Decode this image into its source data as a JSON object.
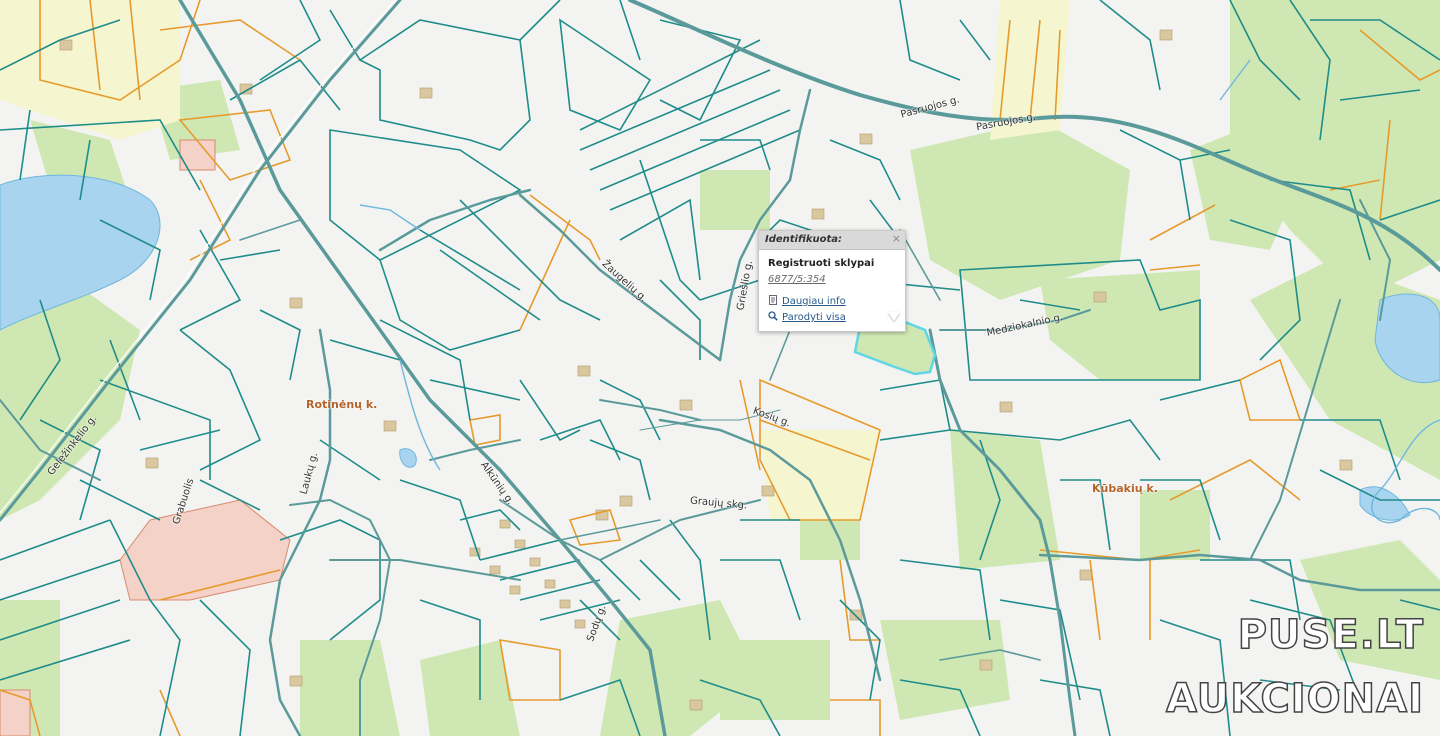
{
  "popup": {
    "title": "Identifikuota:",
    "close_label": "×",
    "layer_label": "Registruoti sklypai",
    "parcel_number": "6877/5:354",
    "more_info_label": "Daugiau info",
    "show_all_label": "Parodyti visa"
  },
  "map_labels": {
    "street_pasruojos_1": "Pasruojos g.",
    "street_pasruojos_2": "Pasruojos g.",
    "street_medziokalnio": "Medziokalnio g.",
    "street_zaugeliu": "Žaugelių g.",
    "street_gruslio": "Griešlio g.",
    "street_kosiu": "Kosių g.",
    "street_gelezinkelio": "Geležinkelio g.",
    "street_alkuoniu": "Alkūnių g.",
    "street_lauko": "Laukų g.",
    "street_grabuolio": "Grabuolis",
    "street_grauju": "Graujų skg.",
    "street_sodu": "Sodų g."
  },
  "villages": {
    "rotinenai": "Rotinėnų k.",
    "kubakiai": "Kūbakių k."
  },
  "watermark": {
    "line1": "PUSE.LT",
    "line2": "AUKCIONAI"
  },
  "colors": {
    "background": "#f3f4f1",
    "forest": "#cfe8b3",
    "water": "#a8d4ef",
    "road": "#5b9a9a",
    "parcel_line": "#1f8c8a",
    "private_parcel": "#e79a2c",
    "selected_parcel": "#5fd6e6",
    "settlement": "#d4c09a"
  }
}
